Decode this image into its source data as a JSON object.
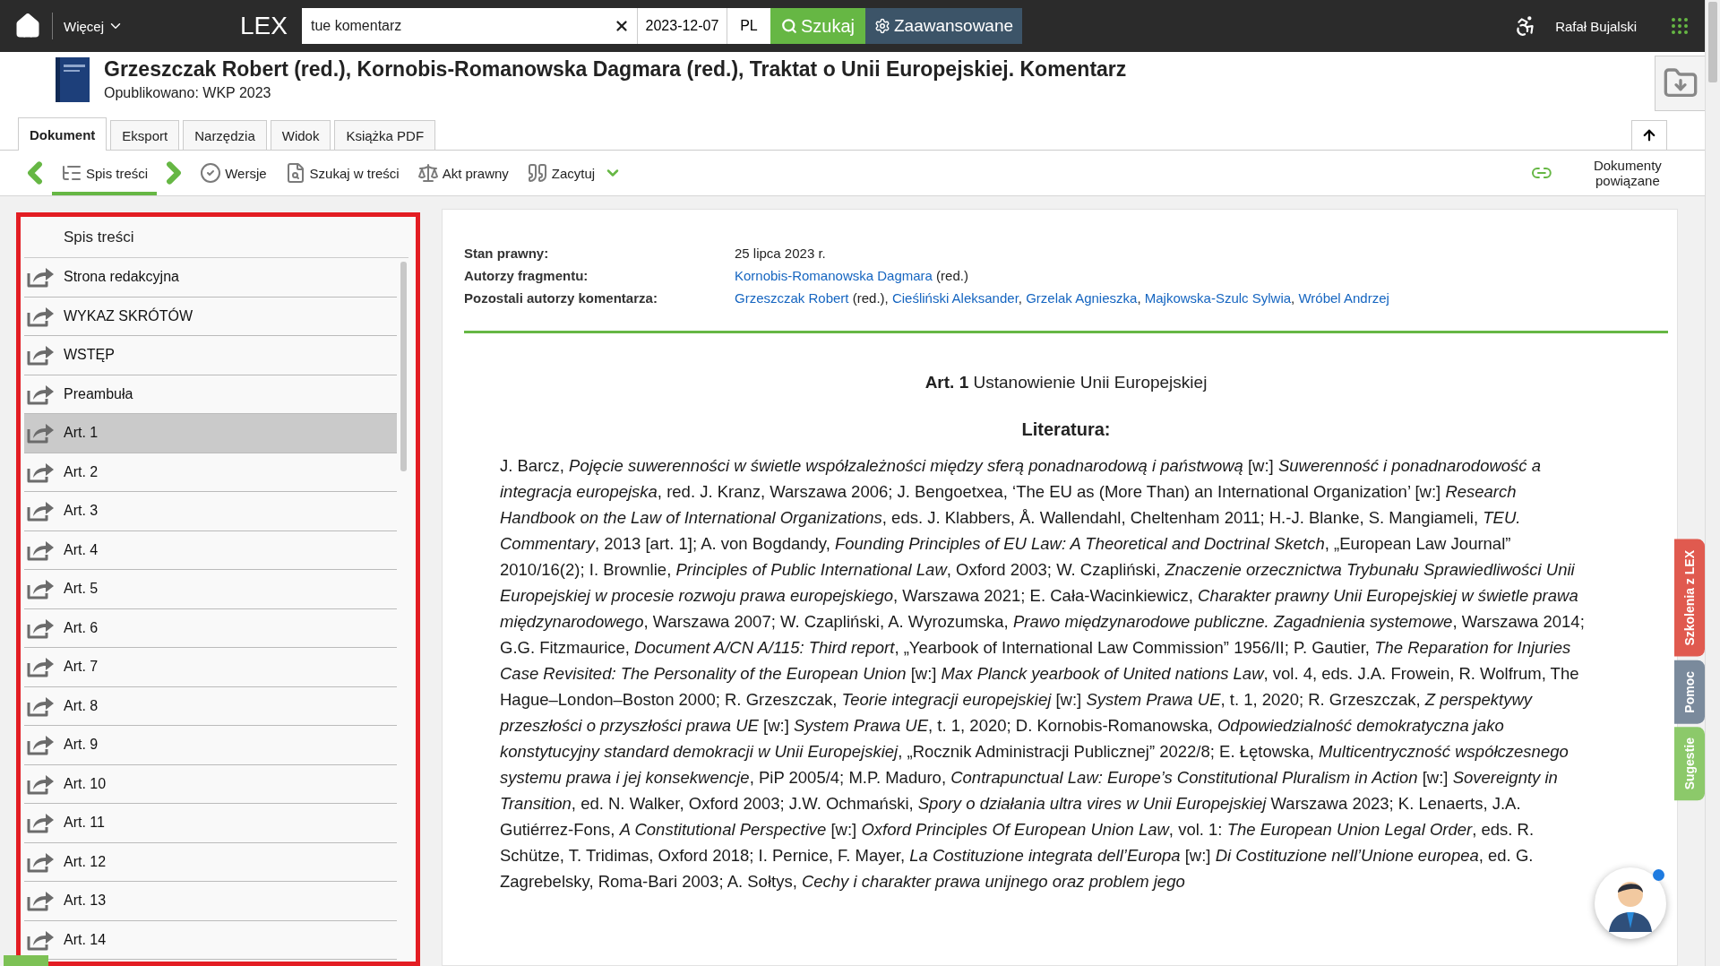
{
  "topbar": {
    "more_menu": "Więcej",
    "logo": "LEX",
    "search": {
      "value": "tue komentarz",
      "date": "2023-12-07",
      "language": "PL"
    },
    "search_button": "Szukaj",
    "advanced_button": "Zaawansowane",
    "user": "Rafał Bujalski"
  },
  "document": {
    "title": "Grzeszczak Robert (red.), Kornobis-Romanowska Dagmara (red.), Traktat o Unii Europejskiej. Komentarz",
    "published": "Opublikowano: WKP 2023"
  },
  "tabs": [
    {
      "label": "Dokument",
      "selected": true
    },
    {
      "label": "Eksport",
      "selected": false
    },
    {
      "label": "Narzędzia",
      "selected": false
    },
    {
      "label": "Widok",
      "selected": false
    },
    {
      "label": "Książka PDF",
      "selected": false
    }
  ],
  "toolbar": {
    "items": [
      {
        "kind": "toc",
        "label": "Spis treści",
        "selected": true,
        "menu": false
      },
      {
        "kind": "versions",
        "label": "Wersje",
        "selected": false,
        "menu": false
      },
      {
        "kind": "search",
        "label": "Szukaj w treści",
        "selected": false,
        "menu": false
      },
      {
        "kind": "act",
        "label": "Akt prawny",
        "selected": false,
        "menu": false
      },
      {
        "kind": "cite",
        "label": "Zacytuj",
        "selected": false,
        "menu": true
      }
    ],
    "related": "Dokumenty powiązane"
  },
  "toc": {
    "title": "Spis treści",
    "items": [
      {
        "label": "Strona redakcyjna",
        "selected": false
      },
      {
        "label": "WYKAZ SKRÓTÓW",
        "selected": false
      },
      {
        "label": "WSTĘP",
        "selected": false
      },
      {
        "label": "Preambuła",
        "selected": false
      },
      {
        "label": "Art. 1",
        "selected": true
      },
      {
        "label": "Art. 2",
        "selected": false
      },
      {
        "label": "Art. 3",
        "selected": false
      },
      {
        "label": "Art. 4",
        "selected": false
      },
      {
        "label": "Art. 5",
        "selected": false
      },
      {
        "label": "Art. 6",
        "selected": false
      },
      {
        "label": "Art. 7",
        "selected": false
      },
      {
        "label": "Art. 8",
        "selected": false
      },
      {
        "label": "Art. 9",
        "selected": false
      },
      {
        "label": "Art. 10",
        "selected": false
      },
      {
        "label": "Art. 11",
        "selected": false
      },
      {
        "label": "Art. 12",
        "selected": false
      },
      {
        "label": "Art. 13",
        "selected": false
      },
      {
        "label": "Art. 14",
        "selected": false
      }
    ]
  },
  "meta": [
    {
      "label": "Stan prawny:",
      "value": [
        {
          "text": "25 lipca 2023 r.",
          "link": false
        }
      ]
    },
    {
      "label": "Autorzy fragmentu:",
      "value": [
        {
          "text": "Kornobis-Romanowska Dagmara",
          "link": true
        },
        {
          "text": " (red.)",
          "link": false
        }
      ]
    },
    {
      "label": "Pozostali autorzy komentarza:",
      "value": [
        {
          "text": "Grzeszczak Robert",
          "link": true
        },
        {
          "text": " (red.), ",
          "link": false
        },
        {
          "text": "Cieśliński Aleksander",
          "link": true
        },
        {
          "text": ", ",
          "link": false
        },
        {
          "text": "Grzelak Agnieszka",
          "link": true
        },
        {
          "text": ", ",
          "link": false
        },
        {
          "text": "Majkowska-Szulc Sylwia",
          "link": true
        },
        {
          "text": ", ",
          "link": false
        },
        {
          "text": "Wróbel Andrzej",
          "link": true
        }
      ]
    }
  ],
  "article_heading": "**Art. 1** Ustanowienie Unii Europejskiej",
  "literature": {
    "heading": "Literatura:",
    "text": "J. Barcz, *Pojęcie suwerenności w świetle współzależności między sferą ponadnarodową i państwową* [w:] *Suwerenność i ponadnarodowość a integracja europejska*, red. J. Kranz, Warszawa 2006; J. Bengoetxea, ‘The EU as (More Than) an International Organization’ [w:] *Research Handbook on the Law of International Organizations*, eds. J. Klabbers, Å. Wallendahl, Cheltenham 2011; H.-J. Blanke, S. Mangiameli, *TEU. Commentary*, 2013 [art. 1]; A. von Bogdandy, *Founding Principles of EU Law: A Theoretical and Doctrinal Sketch*, „European Law Journal” 2010/16(2); I. Brownlie, *Principles of Public International Law*, Oxford 2003; W. Czapliński, *Znaczenie orzecznictwa Trybunału Sprawiedliwości Unii Europejskiej w procesie rozwoju prawa europejskiego*, Warszawa 2021; E. Cała-Wacinkiewicz, *Charakter prawny Unii Europejskiej w świetle prawa międzynarodowego*, Warszawa 2007; W. Czapliński, A. Wyrozumska, *Prawo międzynarodowe publiczne. Zagadnienia systemowe*, Warszawa 2014; G.G. Fitzmaurice, *Document A/CN A/115: Third report*, „Yearbook of International Law Commission” 1956/II; P. Gautier, *The Reparation for Injuries Case Revisited: The Personality of the European Union* [w:] *Max Planck yearbook of United nations Law*, vol. 4, eds. J.A. Frowein, R. Wolfrum, The Hague–London–Boston 2000; R. Grzeszczak, *Teorie integracji europejskiej* [w:] *System Prawa UE*, t. 1, 2020; R. Grzeszczak, *Z perspektywy przeszłości o przyszłości prawa UE* [w:] *System Prawa UE*, t. 1, 2020; D. Kornobis-Romanowska, *Odpowiedzialność demokratyczna jako konstytucyjny standard demokracji w Unii Europejskiej*, „Rocznik Administracji Publicznej” 2022/8; E. Łętowska, *Multicentryczność współczesnego systemu prawa i jej konsekwencje*, PiP 2005/4; M.P. Maduro, *Contrapunctual Law: Europe’s Constitutional Pluralism in Action* [w:] *Sovereignty in Transition*, ed. N. Walker, Oxford 2003; J.W. Ochmański, *Spory o działania ultra vires w Unii Europejskiej* Warszawa 2023; K. Lenaerts, J.A. Gutiérrez-Fons, *A Constitutional Perspective* [w:] *Oxford Principles Of European Union Law*, vol. 1: *The European Union Legal Order*, eds. R. Schütze, T. Tridimas, Oxford 2018; I. Pernice, F. Mayer, *La Costituzione integrata dell’Europa* [w:] *Di Costituzione nell’Unione europea*, ed. G. Zagrebelsky, Roma-Bari 2003; A. Sołtys, *Cechy i charakter prawa unijnego oraz problem jego*"
  },
  "side_tabs": [
    {
      "label": "Szkolenia z LEX",
      "color": "#e05a4f"
    },
    {
      "label": "Pomoc",
      "color": "#7a8a9c"
    },
    {
      "label": "Sugestie",
      "color": "#8cc96a"
    }
  ]
}
